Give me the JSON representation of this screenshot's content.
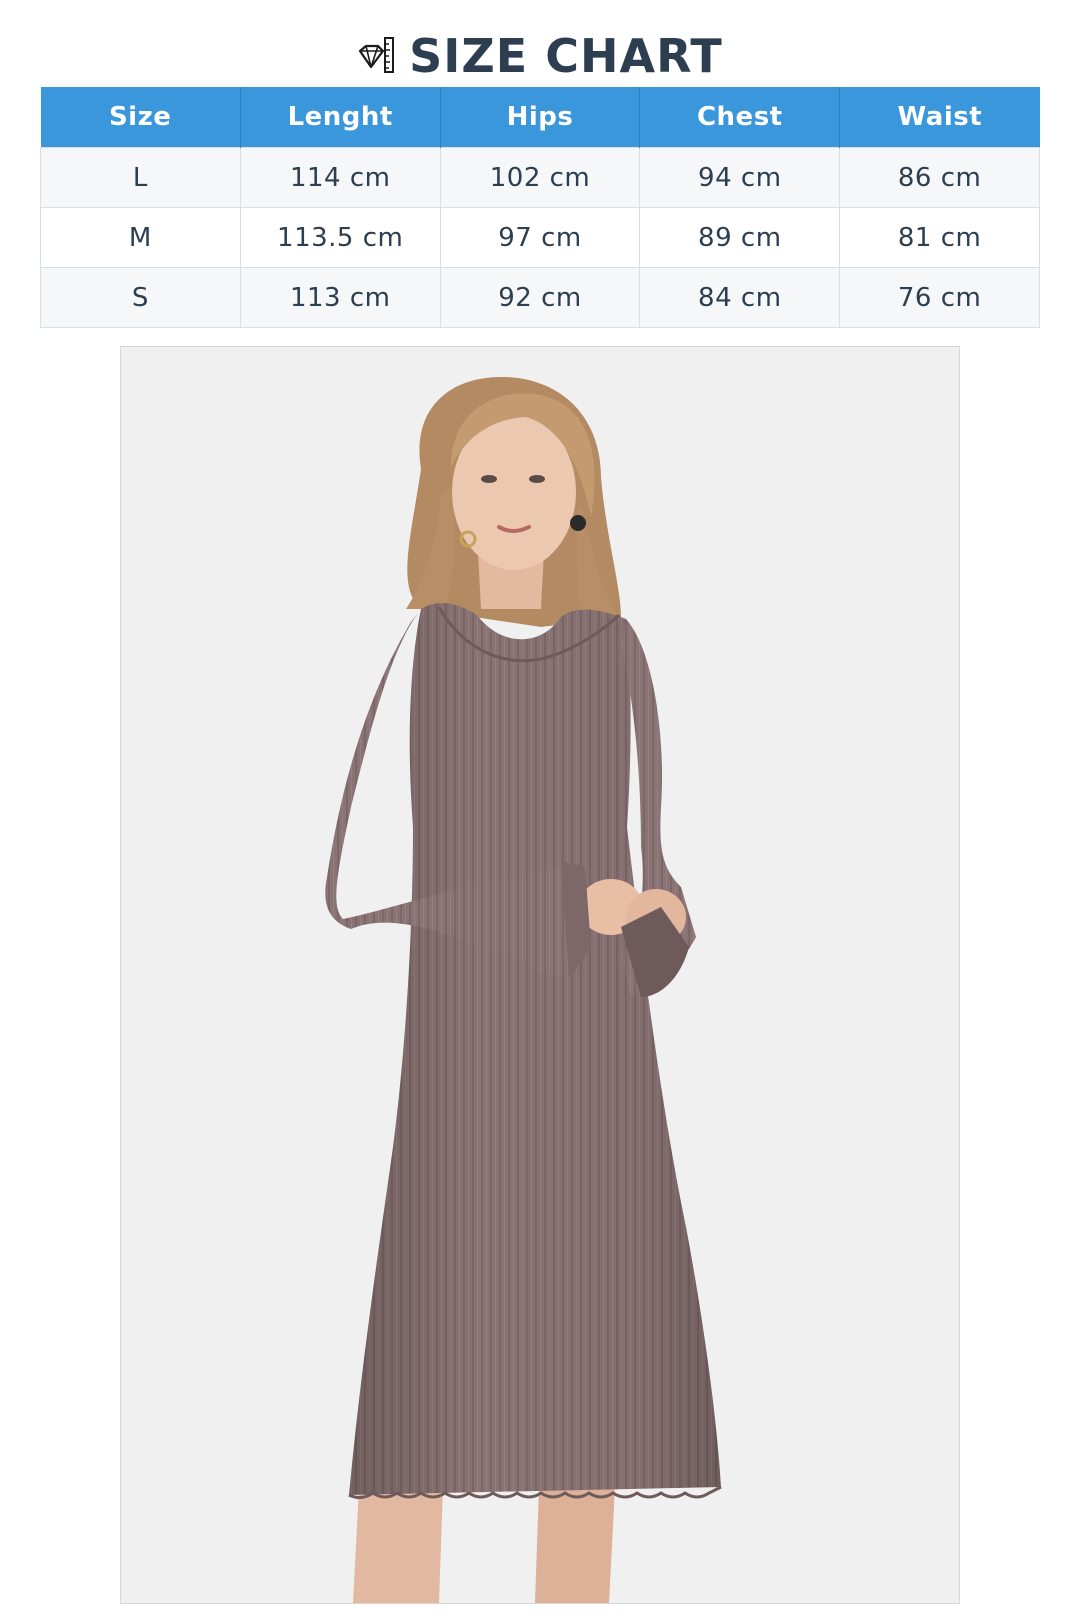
{
  "header": {
    "title": "SIZE CHART",
    "icon": "ruler-diamond-icon"
  },
  "table": {
    "columns": [
      "Size",
      "Lenght",
      "Hips",
      "Chest",
      "Waist"
    ],
    "rows": [
      [
        "L",
        "114 cm",
        "102 cm",
        "94 cm",
        "86 cm"
      ],
      [
        "M",
        "113.5 cm",
        "97 cm",
        "89 cm",
        "81 cm"
      ],
      [
        "S",
        "113 cm",
        "92 cm",
        "84 cm",
        "76 cm"
      ]
    ]
  },
  "colors": {
    "header_bg": "#3a97db",
    "title_text": "#2c3e50",
    "dress": "#8a7374",
    "photo_bg": "#f0f0f0"
  }
}
